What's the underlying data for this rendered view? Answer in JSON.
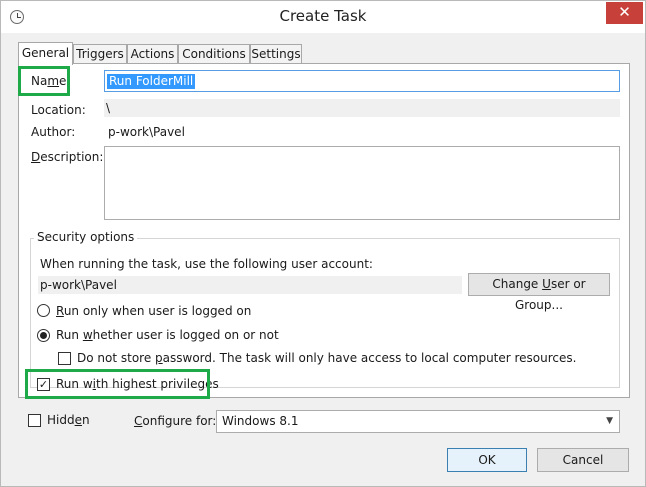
{
  "window": {
    "title": "Create Task",
    "close_glyph": "✕"
  },
  "tabs": [
    {
      "label": "General",
      "active": true
    },
    {
      "label": "Triggers",
      "active": false
    },
    {
      "label": "Actions",
      "active": false
    },
    {
      "label": "Conditions",
      "active": false
    },
    {
      "label": "Settings",
      "active": false
    }
  ],
  "general": {
    "name_label": {
      "a": "Na",
      "b": "m",
      "c": "e:"
    },
    "name_value": "Run FolderMill",
    "location_label": "Location:",
    "location_value": "\\",
    "author_label": "Author:",
    "author_value": "p-work\\Pavel",
    "description_label": {
      "a": "D",
      "b": "escription:"
    },
    "description_value": ""
  },
  "security": {
    "group_title": "Security options",
    "account_prompt": "When running the task, use the following user account:",
    "account_value": "p-work\\Pavel",
    "change_user_button": {
      "a": "Change ",
      "b": "U",
      "c": "ser or Group..."
    },
    "radio_logged_on": {
      "a": "R",
      "b": "un only when user is logged on",
      "checked": false
    },
    "radio_whether": {
      "a": "Run ",
      "b": "w",
      "c": "hether user is logged on or not",
      "checked": true
    },
    "no_store_password": {
      "a": "Do not store ",
      "b": "p",
      "c": "assword.  The task will only have access to local computer resources.",
      "checked": false
    },
    "highest_privileges": {
      "a": "Run w",
      "b": "i",
      "c": "th highest privileges",
      "checked": true
    }
  },
  "footer": {
    "hidden": {
      "a": "Hidd",
      "b": "e",
      "c": "n",
      "checked": false
    },
    "configure_label": {
      "a": "C",
      "b": "onfigure for:"
    },
    "configure_value": "Windows 8.1",
    "ok_label": "OK",
    "cancel_label": "Cancel"
  },
  "colors": {
    "highlight": "#1faa4a",
    "selection": "#3399ff",
    "close": "#c7403a"
  }
}
